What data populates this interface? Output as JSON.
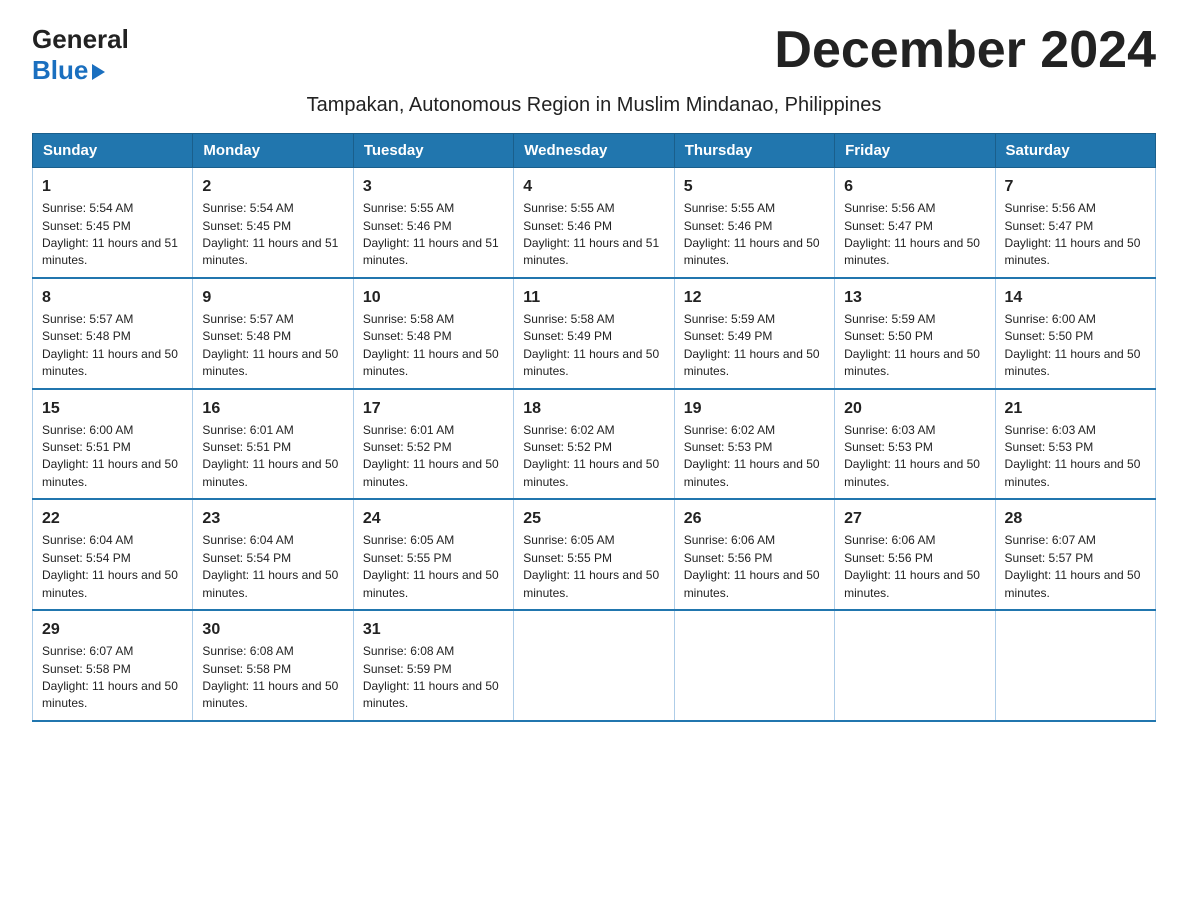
{
  "logo": {
    "line1": "General",
    "line2": "Blue"
  },
  "title": "December 2024",
  "subtitle": "Tampakan, Autonomous Region in Muslim Mindanao, Philippines",
  "days_of_week": [
    "Sunday",
    "Monday",
    "Tuesday",
    "Wednesday",
    "Thursday",
    "Friday",
    "Saturday"
  ],
  "weeks": [
    [
      {
        "num": "1",
        "sunrise": "5:54 AM",
        "sunset": "5:45 PM",
        "daylight": "11 hours and 51 minutes."
      },
      {
        "num": "2",
        "sunrise": "5:54 AM",
        "sunset": "5:45 PM",
        "daylight": "11 hours and 51 minutes."
      },
      {
        "num": "3",
        "sunrise": "5:55 AM",
        "sunset": "5:46 PM",
        "daylight": "11 hours and 51 minutes."
      },
      {
        "num": "4",
        "sunrise": "5:55 AM",
        "sunset": "5:46 PM",
        "daylight": "11 hours and 51 minutes."
      },
      {
        "num": "5",
        "sunrise": "5:55 AM",
        "sunset": "5:46 PM",
        "daylight": "11 hours and 50 minutes."
      },
      {
        "num": "6",
        "sunrise": "5:56 AM",
        "sunset": "5:47 PM",
        "daylight": "11 hours and 50 minutes."
      },
      {
        "num": "7",
        "sunrise": "5:56 AM",
        "sunset": "5:47 PM",
        "daylight": "11 hours and 50 minutes."
      }
    ],
    [
      {
        "num": "8",
        "sunrise": "5:57 AM",
        "sunset": "5:48 PM",
        "daylight": "11 hours and 50 minutes."
      },
      {
        "num": "9",
        "sunrise": "5:57 AM",
        "sunset": "5:48 PM",
        "daylight": "11 hours and 50 minutes."
      },
      {
        "num": "10",
        "sunrise": "5:58 AM",
        "sunset": "5:48 PM",
        "daylight": "11 hours and 50 minutes."
      },
      {
        "num": "11",
        "sunrise": "5:58 AM",
        "sunset": "5:49 PM",
        "daylight": "11 hours and 50 minutes."
      },
      {
        "num": "12",
        "sunrise": "5:59 AM",
        "sunset": "5:49 PM",
        "daylight": "11 hours and 50 minutes."
      },
      {
        "num": "13",
        "sunrise": "5:59 AM",
        "sunset": "5:50 PM",
        "daylight": "11 hours and 50 minutes."
      },
      {
        "num": "14",
        "sunrise": "6:00 AM",
        "sunset": "5:50 PM",
        "daylight": "11 hours and 50 minutes."
      }
    ],
    [
      {
        "num": "15",
        "sunrise": "6:00 AM",
        "sunset": "5:51 PM",
        "daylight": "11 hours and 50 minutes."
      },
      {
        "num": "16",
        "sunrise": "6:01 AM",
        "sunset": "5:51 PM",
        "daylight": "11 hours and 50 minutes."
      },
      {
        "num": "17",
        "sunrise": "6:01 AM",
        "sunset": "5:52 PM",
        "daylight": "11 hours and 50 minutes."
      },
      {
        "num": "18",
        "sunrise": "6:02 AM",
        "sunset": "5:52 PM",
        "daylight": "11 hours and 50 minutes."
      },
      {
        "num": "19",
        "sunrise": "6:02 AM",
        "sunset": "5:53 PM",
        "daylight": "11 hours and 50 minutes."
      },
      {
        "num": "20",
        "sunrise": "6:03 AM",
        "sunset": "5:53 PM",
        "daylight": "11 hours and 50 minutes."
      },
      {
        "num": "21",
        "sunrise": "6:03 AM",
        "sunset": "5:53 PM",
        "daylight": "11 hours and 50 minutes."
      }
    ],
    [
      {
        "num": "22",
        "sunrise": "6:04 AM",
        "sunset": "5:54 PM",
        "daylight": "11 hours and 50 minutes."
      },
      {
        "num": "23",
        "sunrise": "6:04 AM",
        "sunset": "5:54 PM",
        "daylight": "11 hours and 50 minutes."
      },
      {
        "num": "24",
        "sunrise": "6:05 AM",
        "sunset": "5:55 PM",
        "daylight": "11 hours and 50 minutes."
      },
      {
        "num": "25",
        "sunrise": "6:05 AM",
        "sunset": "5:55 PM",
        "daylight": "11 hours and 50 minutes."
      },
      {
        "num": "26",
        "sunrise": "6:06 AM",
        "sunset": "5:56 PM",
        "daylight": "11 hours and 50 minutes."
      },
      {
        "num": "27",
        "sunrise": "6:06 AM",
        "sunset": "5:56 PM",
        "daylight": "11 hours and 50 minutes."
      },
      {
        "num": "28",
        "sunrise": "6:07 AM",
        "sunset": "5:57 PM",
        "daylight": "11 hours and 50 minutes."
      }
    ],
    [
      {
        "num": "29",
        "sunrise": "6:07 AM",
        "sunset": "5:58 PM",
        "daylight": "11 hours and 50 minutes."
      },
      {
        "num": "30",
        "sunrise": "6:08 AM",
        "sunset": "5:58 PM",
        "daylight": "11 hours and 50 minutes."
      },
      {
        "num": "31",
        "sunrise": "6:08 AM",
        "sunset": "5:59 PM",
        "daylight": "11 hours and 50 minutes."
      },
      null,
      null,
      null,
      null
    ]
  ]
}
